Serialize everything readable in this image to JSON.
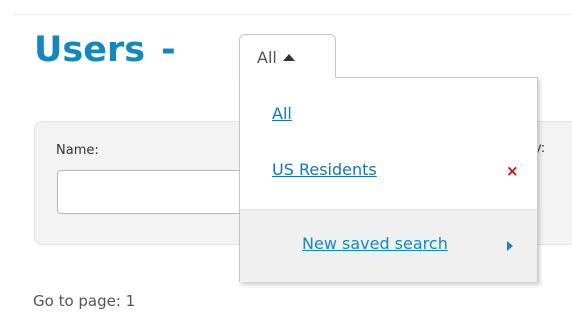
{
  "header": {
    "title": "Users",
    "separator": "-"
  },
  "saved_search_dropdown": {
    "selected": "All",
    "state": "expanded",
    "items": [
      {
        "label": "All"
      },
      {
        "label": "US Residents",
        "delete_symbol": "×"
      }
    ],
    "new_saved_search_label": "New saved search"
  },
  "search_form": {
    "name_label": "Name:",
    "partial_label": "y:",
    "name_value": ""
  },
  "pagination": {
    "goto_label": "Go to page: 1"
  },
  "icons": {
    "dropdown_caret": "caret-up-icon",
    "delete": "delete-x-icon",
    "new_search_arrow": "caret-right-icon"
  },
  "colors": {
    "title_blue": "#1288c2",
    "link_blue": "#1278b5",
    "delete_red": "#cc1111",
    "panel_gray": "#f3f3f3"
  }
}
